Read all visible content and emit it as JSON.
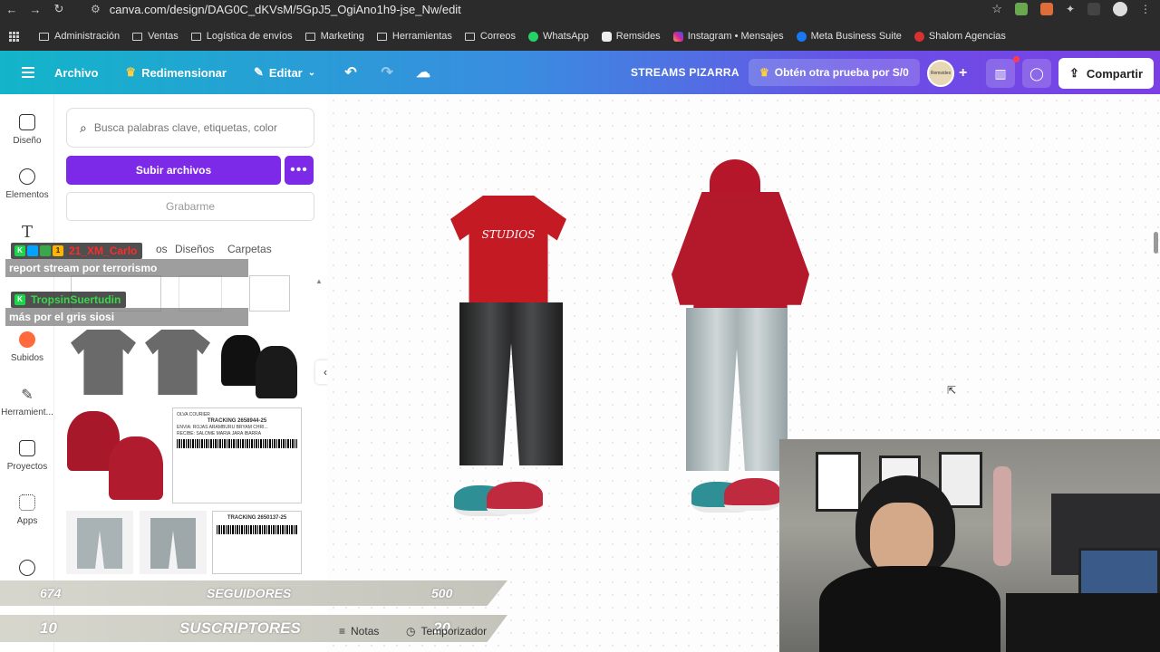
{
  "browser": {
    "url": "canva.com/design/DAG0C_dKVsM/5GpJ5_OgiAno1h9-jse_Nw/edit",
    "bookmarks": [
      {
        "label": "Administración",
        "type": "folder"
      },
      {
        "label": "Ventas",
        "type": "folder"
      },
      {
        "label": "Logística de envíos",
        "type": "folder"
      },
      {
        "label": "Marketing",
        "type": "folder"
      },
      {
        "label": "Herramientas",
        "type": "folder"
      },
      {
        "label": "Correos",
        "type": "folder"
      },
      {
        "label": "WhatsApp",
        "type": "site"
      },
      {
        "label": "Remsides",
        "type": "site"
      },
      {
        "label": "Instagram • Mensajes",
        "type": "site"
      },
      {
        "label": "Meta Business Suite",
        "type": "site"
      },
      {
        "label": "Shalom Agencias",
        "type": "site"
      }
    ]
  },
  "toolbar": {
    "archivo": "Archivo",
    "redimensionar": "Redimensionar",
    "editar": "Editar",
    "project_title": "STREAMS PIZARRA",
    "trial": "Obtén otra prueba por S/0",
    "share": "Compartir",
    "avatar_text": "Remsides",
    "accent": "#7d2ae8"
  },
  "rail": [
    {
      "label": "Diseño",
      "icon": "layout-icon"
    },
    {
      "label": "Elementos",
      "icon": "shapes-icon"
    },
    {
      "label": "Subidos",
      "icon": "upload-cloud-icon"
    },
    {
      "label": "Herramient...",
      "icon": "pen-icon"
    },
    {
      "label": "Proyectos",
      "icon": "folder-icon"
    },
    {
      "label": "Apps",
      "icon": "apps-icon"
    }
  ],
  "panel": {
    "search_placeholder": "Busca palabras clave, etiquetas, color",
    "upload_label": "Subir archivos",
    "record_label": "Grabarme",
    "tab_partial": "os",
    "tab_designs": "Diseños",
    "tab_folders": "Carpetas"
  },
  "chat": [
    {
      "user": "21_XM_Carlo",
      "message": "report stream por terrorismo",
      "user_color": "#ff2b2b"
    },
    {
      "user": "TropsinSuertudin",
      "message": "más por el gris siosi",
      "user_color": "#38d84a"
    }
  ],
  "stats": {
    "followers_current": "674",
    "followers_label": "SEGUIDORES",
    "followers_goal": "500",
    "subs_current": "10",
    "subs_label": "SUSCRIPTORES",
    "subs_goal": "20"
  },
  "bottom": {
    "notes": "Notas",
    "timer": "Temporizador"
  },
  "labels": {
    "tracking1": "TRACKING 2658944-25",
    "tracking2": "TRACKING 2650137-25",
    "courier": "OLVA COURIER",
    "envia1": "ENVIA: ROJAS ARAMBURU BRYAM CHRI...",
    "recibe1": "RECIBE: SALOME MARIA JARA IBARRA"
  },
  "tee_text": "STUDIOS"
}
